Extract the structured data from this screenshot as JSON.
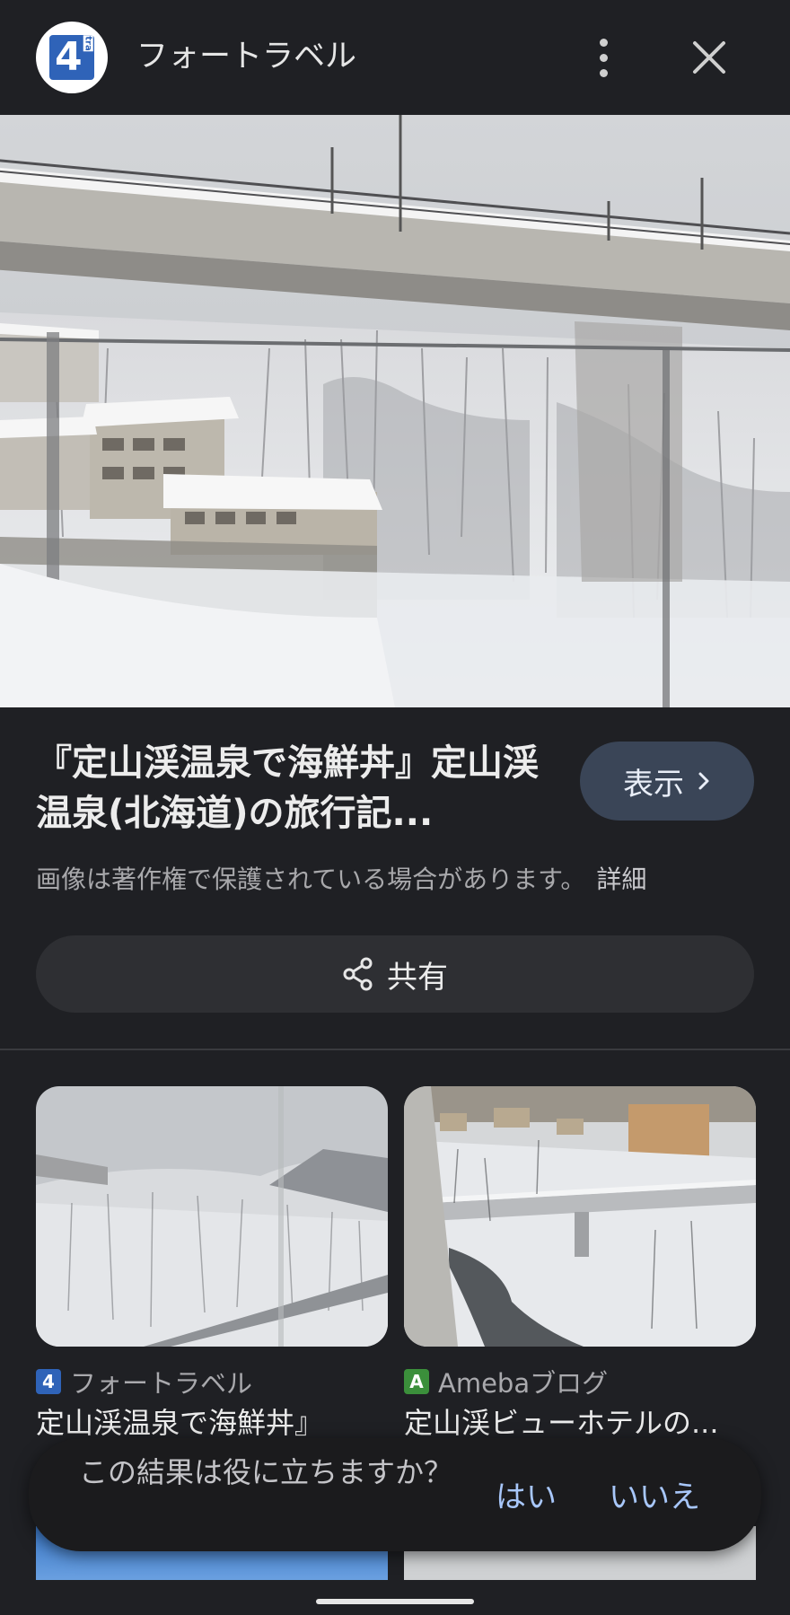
{
  "header": {
    "site_name": "フォートラベル",
    "logo_text": "4",
    "logo_small": "tra",
    "menu_icon": "more-vert-icon",
    "close_icon": "close-icon"
  },
  "result": {
    "title": "『定山渓温泉で海鮮丼』定山渓温泉(北海道)の旅行記...",
    "view_label": "表示",
    "copyright_notice": "画像は著作権で保護されている場合があります。",
    "detail_link": "詳細",
    "share_label": "共有"
  },
  "related": [
    {
      "source": "フォートラベル",
      "title": "定山渓温泉で海鮮丼』",
      "favicon_color": "#2f63b8",
      "favicon_text": "4"
    },
    {
      "source": "Amebaブログ",
      "title": "定山渓ビューホテルの...",
      "favicon_color": "#3b8f3b",
      "favicon_text": "A"
    }
  ],
  "feedback": {
    "question": "この結果は役に立ちますか？",
    "yes": "はい",
    "no": "いいえ"
  },
  "colors": {
    "background": "#1f2024",
    "accent": "#a8c7fa",
    "view_button": "#3a4557"
  }
}
